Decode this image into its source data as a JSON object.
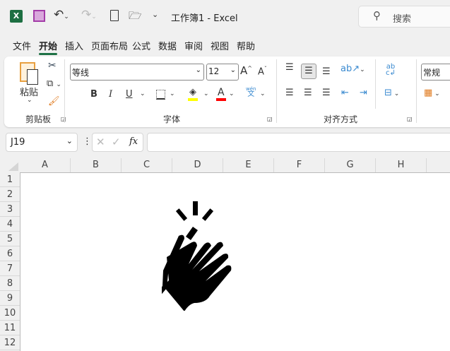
{
  "titlebar": {
    "title": "工作簿1  -  Excel",
    "search_placeholder": "搜索",
    "app_icon": "excel-icon",
    "quick": [
      "save-icon",
      "undo-icon",
      "redo-icon",
      "new-file-icon",
      "open-folder-icon",
      "customize-icon"
    ]
  },
  "tabs": [
    {
      "label": "文件"
    },
    {
      "label": "开始",
      "active": true
    },
    {
      "label": "插入"
    },
    {
      "label": "页面布局"
    },
    {
      "label": "公式"
    },
    {
      "label": "数据"
    },
    {
      "label": "审阅"
    },
    {
      "label": "视图"
    },
    {
      "label": "帮助"
    }
  ],
  "ribbon": {
    "clipboard": {
      "label": "剪贴板",
      "paste": "粘贴"
    },
    "font": {
      "label": "字体",
      "font_name": "等线",
      "font_size": "12",
      "bold": "B",
      "italic": "I",
      "underline": "U",
      "font_color": "A",
      "grow": "A",
      "shrink": "A",
      "phonetic_top": "wén",
      "phonetic_bottom": "文",
      "fill_color": "#ffff00",
      "text_color": "#ff0000"
    },
    "alignment": {
      "label": "对齐方式"
    },
    "number": {
      "format": "常规"
    }
  },
  "formula_bar": {
    "name_box": "J19",
    "fx": "fx",
    "value": ""
  },
  "columns": [
    "A",
    "B",
    "C",
    "D",
    "E",
    "F",
    "G",
    "H"
  ],
  "rows": [
    "1",
    "2",
    "3",
    "4",
    "5",
    "6",
    "7",
    "8",
    "9",
    "10",
    "11",
    "12"
  ],
  "picture": {
    "icon": "clapping-hands-icon"
  }
}
